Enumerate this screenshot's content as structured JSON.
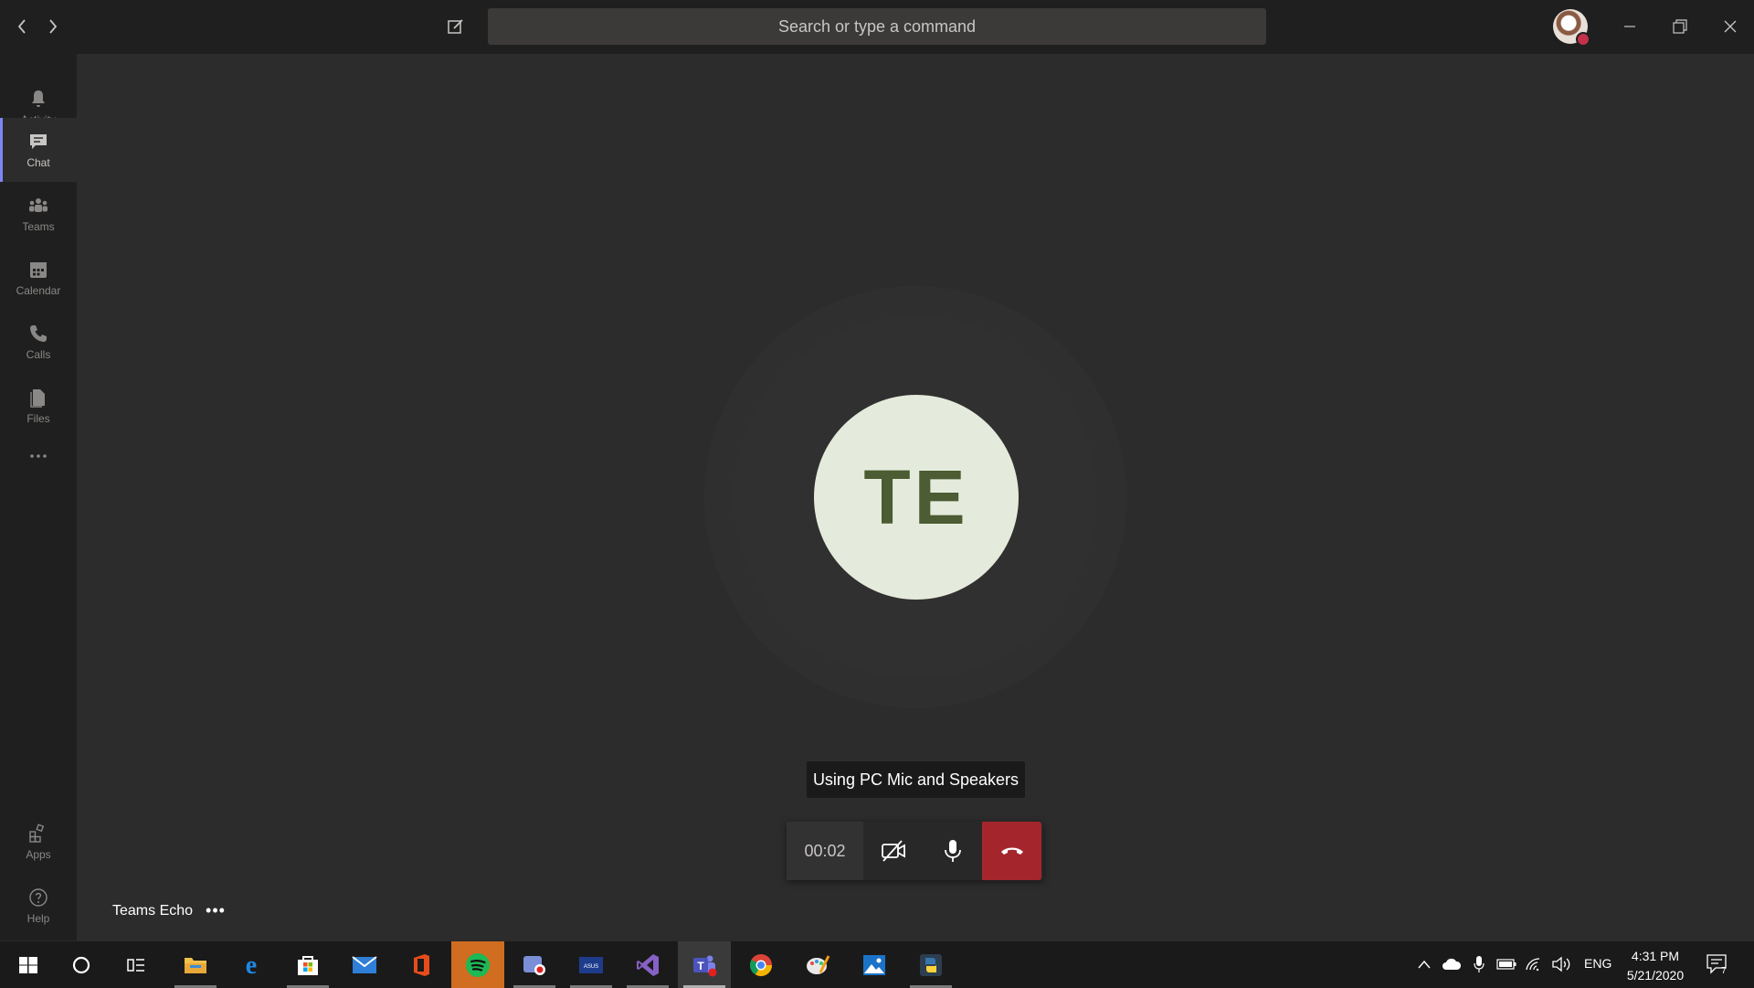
{
  "titlebar": {
    "search_placeholder": "Search or type a command"
  },
  "rail": {
    "items": [
      {
        "label": "Activity",
        "icon": "bell-icon"
      },
      {
        "label": "Chat",
        "icon": "chat-icon",
        "active": true
      },
      {
        "label": "Teams",
        "icon": "teams-icon"
      },
      {
        "label": "Calendar",
        "icon": "calendar-icon"
      },
      {
        "label": "Calls",
        "icon": "phone-icon"
      },
      {
        "label": "Files",
        "icon": "files-icon"
      }
    ],
    "bottom_items": [
      {
        "label": "Apps",
        "icon": "apps-icon"
      },
      {
        "label": "Help",
        "icon": "help-icon"
      }
    ]
  },
  "call": {
    "initials": "TE",
    "audio_status": "Using PC Mic and Speakers",
    "duration": "00:02",
    "caller_name": "Teams Echo",
    "more_label": "•••"
  },
  "taskbar": {
    "language": "ENG",
    "time": "4:31 PM",
    "date": "5/21/2020",
    "notification_count": "7",
    "colors": {
      "accent": "#7f85f5",
      "hangup": "#a4262c",
      "avatar_bg": "#e5ebdc",
      "avatar_text": "#4c5c33"
    }
  }
}
